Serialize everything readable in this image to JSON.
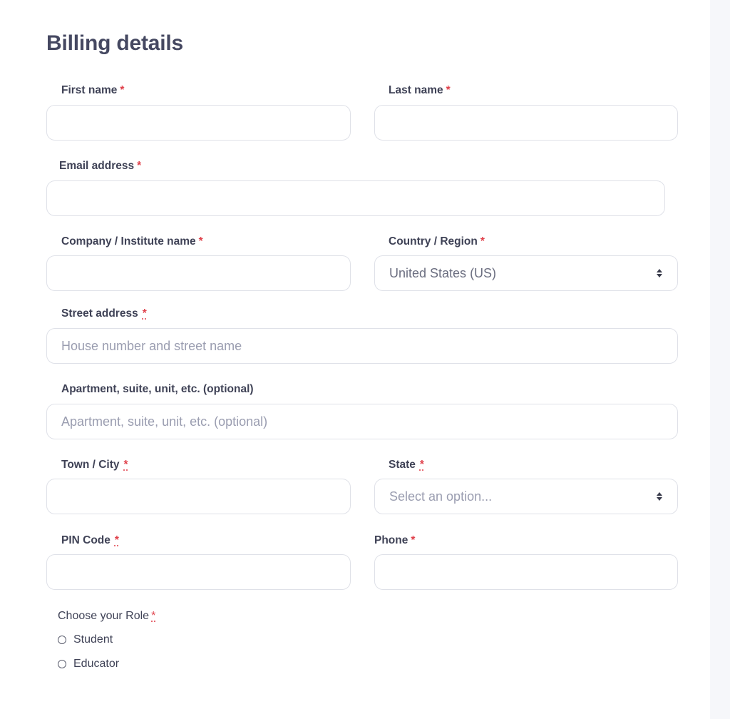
{
  "form": {
    "title": "Billing details",
    "required_mark": "*",
    "first_name": {
      "label": "First name",
      "value": "",
      "placeholder": ""
    },
    "last_name": {
      "label": "Last name",
      "value": "",
      "placeholder": ""
    },
    "email": {
      "label": "Email address",
      "value": "",
      "placeholder": ""
    },
    "company": {
      "label": "Company / Institute name",
      "value": "",
      "placeholder": ""
    },
    "country": {
      "label": "Country / Region",
      "selected": "United States (US)"
    },
    "street": {
      "label": "Street address",
      "value": "",
      "placeholder": "House number and street name"
    },
    "apartment": {
      "label": "Apartment, suite, unit, etc. (optional)",
      "value": "",
      "placeholder": "Apartment, suite, unit, etc. (optional)"
    },
    "city": {
      "label": "Town / City",
      "value": "",
      "placeholder": ""
    },
    "state": {
      "label": "State",
      "selected": "Select an option..."
    },
    "pin": {
      "label": "PIN Code",
      "value": "",
      "placeholder": ""
    },
    "phone": {
      "label": "Phone",
      "value": "",
      "placeholder": ""
    },
    "role": {
      "label": "Choose your Role",
      "options": [
        "Student",
        "Educator"
      ]
    }
  },
  "icons": {
    "select_arrow": "up-down-caret-icon",
    "radio": "radio-unchecked-icon"
  },
  "colors": {
    "required": "#e0424c",
    "title": "#454861",
    "border": "#dfe1e8",
    "side_strip": "#f6f7fa"
  }
}
